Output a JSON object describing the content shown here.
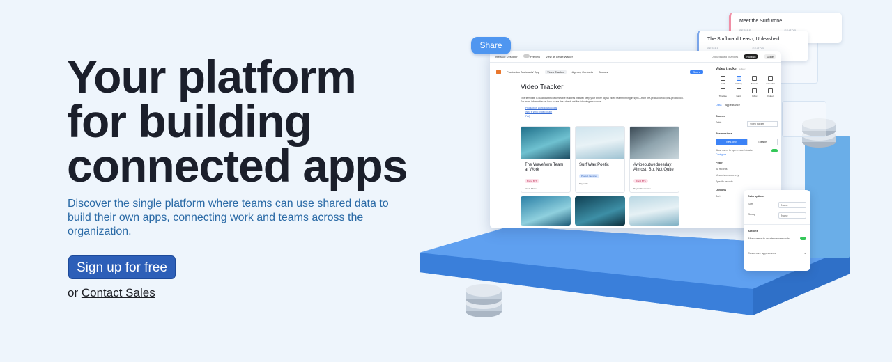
{
  "hero": {
    "title_line1": "Your platform",
    "title_line2": "for building",
    "title_line3": "connected apps",
    "subtitle": "Discover the single platform where teams can use shared data to build their own apps, connecting work and teams across the organization.",
    "cta_label": "Sign up for free",
    "or_text": "or",
    "contact_label": "Contact Sales"
  },
  "illustration": {
    "share_bubble": "Share",
    "cards": [
      {
        "title": "Meet the SurfDrone",
        "meta1": "SERIES",
        "meta2": "EDITOR"
      },
      {
        "title": "The Surfboard Leash, Unleashed",
        "meta1": "SERIES",
        "meta2": "EDITOR"
      }
    ],
    "topbar": {
      "designer": "Interface Designer",
      "preview": "Preview",
      "viewing": "View as Leslie Walker",
      "unpublished": "Unpublished changes",
      "publish": "Publish",
      "done": "Done"
    },
    "nav": {
      "app_name": "Production Assistants' App",
      "tabs": [
        "Video Tracker",
        "Agency Contacts",
        "Scenes"
      ],
      "share": "Share"
    },
    "page_title": "Video Tracker",
    "description": "This template is loaded with customizable features that will keep your entire digital video team running in sync—from pre-production to post-production. For more information on how to use this, check out the following resources:",
    "links": [
      "Production Workflow tutorials",
      "Who's Who: Video Team",
      "FAQ"
    ],
    "tiles": [
      {
        "name": "The Waveform Team at Work",
        "tag": "Brand BTS",
        "who": "Alexis Pham",
        "tag_bg": "#fde2ea",
        "tag_fg": "#c0325a"
      },
      {
        "name": "Surf Wax Poetic",
        "tag": "Product launches",
        "who": "Skyler Xu",
        "tag_bg": "#dde9fd",
        "tag_fg": "#2d5fb8"
      },
      {
        "name": "#wipeoutwednesday: Almost, But Not Quite",
        "tag": "Brand BTS",
        "who": "Peyton Devereaux",
        "tag_bg": "#fde2ea",
        "tag_fg": "#c0325a"
      }
    ],
    "panel": {
      "header": "Video tracker",
      "header_sub": "Gallery",
      "layouts": [
        "Grid",
        "Gallery",
        "Kanban",
        "Calendar",
        "Timeline",
        "Gantt",
        "Inbox",
        "Folder"
      ],
      "tabs": [
        "Data",
        "Appearance"
      ],
      "source": "Source",
      "table_label": "Table",
      "table_value": "Video tracker",
      "permissions": "Permissions",
      "perm_options": [
        "View-only",
        "Editable"
      ],
      "perm_note": "Allow users to open record details",
      "configure": "Configure",
      "filter": "Filter",
      "filter_rows": [
        "All records",
        "Viewer's records only",
        "Specific records"
      ],
      "options": "Options",
      "sort": "Sort"
    },
    "data_options": {
      "title": "Data options",
      "sort_label": "Sort",
      "sort_value": "None",
      "group_label": "Group",
      "group_value": "None",
      "actions": "Actions",
      "actions_note": "Allow users to create new records",
      "customize": "Customize appearance"
    }
  }
}
